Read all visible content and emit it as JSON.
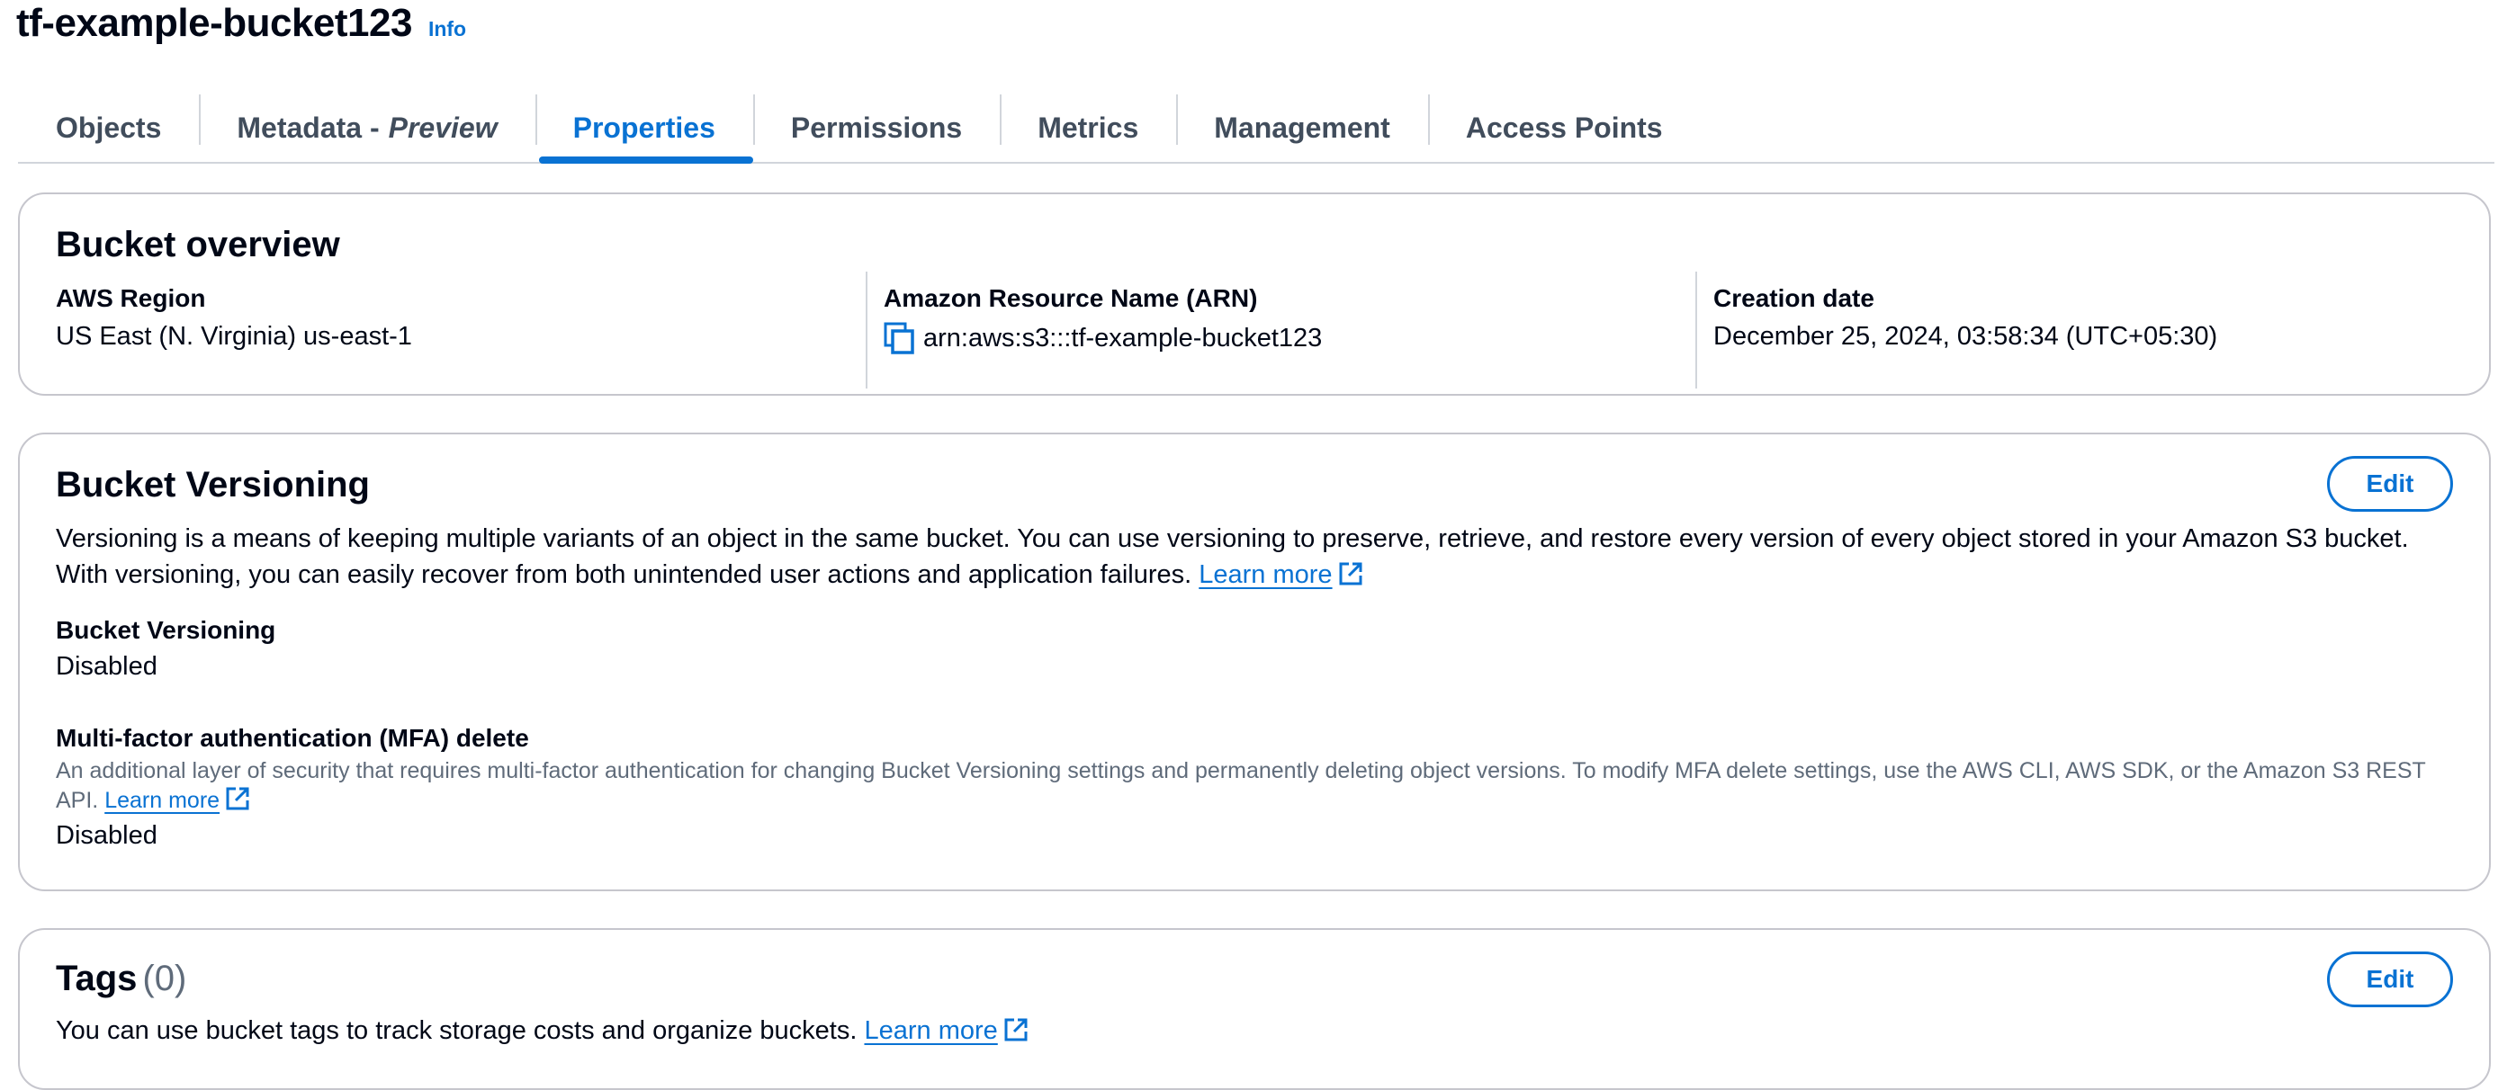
{
  "header": {
    "title": "tf-example-bucket123",
    "info_label": "Info"
  },
  "tabs": [
    {
      "label": "Objects"
    },
    {
      "label": "Metadata -",
      "suffix": "Preview"
    },
    {
      "label": "Properties",
      "active": true
    },
    {
      "label": "Permissions"
    },
    {
      "label": "Metrics"
    },
    {
      "label": "Management"
    },
    {
      "label": "Access Points"
    }
  ],
  "overview": {
    "title": "Bucket overview",
    "region_label": "AWS Region",
    "region_value": "US East (N. Virginia) us-east-1",
    "arn_label": "Amazon Resource Name (ARN)",
    "arn_value": "arn:aws:s3:::tf-example-bucket123",
    "created_label": "Creation date",
    "created_value": "December 25, 2024, 03:58:34 (UTC+05:30)"
  },
  "versioning": {
    "title": "Bucket Versioning",
    "edit_label": "Edit",
    "description": "Versioning is a means of keeping multiple variants of an object in the same bucket. You can use versioning to preserve, retrieve, and restore every version of every object stored in your Amazon S3 bucket. With versioning, you can easily recover from both unintended user actions and application failures.",
    "learn_more": "Learn more",
    "status_label": "Bucket Versioning",
    "status_value": "Disabled",
    "mfa_label": "Multi-factor authentication (MFA) delete",
    "mfa_description": "An additional layer of security that requires multi-factor authentication for changing Bucket Versioning settings and permanently deleting object versions. To modify MFA delete settings, use the AWS CLI, AWS SDK, or the Amazon S3 REST API.",
    "mfa_learn_more": "Learn more",
    "mfa_value": "Disabled"
  },
  "tags": {
    "title": "Tags",
    "count": "(0)",
    "edit_label": "Edit",
    "description": "You can use bucket tags to track storage costs and organize buckets.",
    "learn_more": "Learn more"
  },
  "colors": {
    "accent": "#0972d3",
    "text": "#000716",
    "secondary_text": "#5f6b7a",
    "border": "#c6c6cd"
  },
  "icons": {
    "copy": "copy-icon",
    "external_link": "external-link-icon"
  }
}
